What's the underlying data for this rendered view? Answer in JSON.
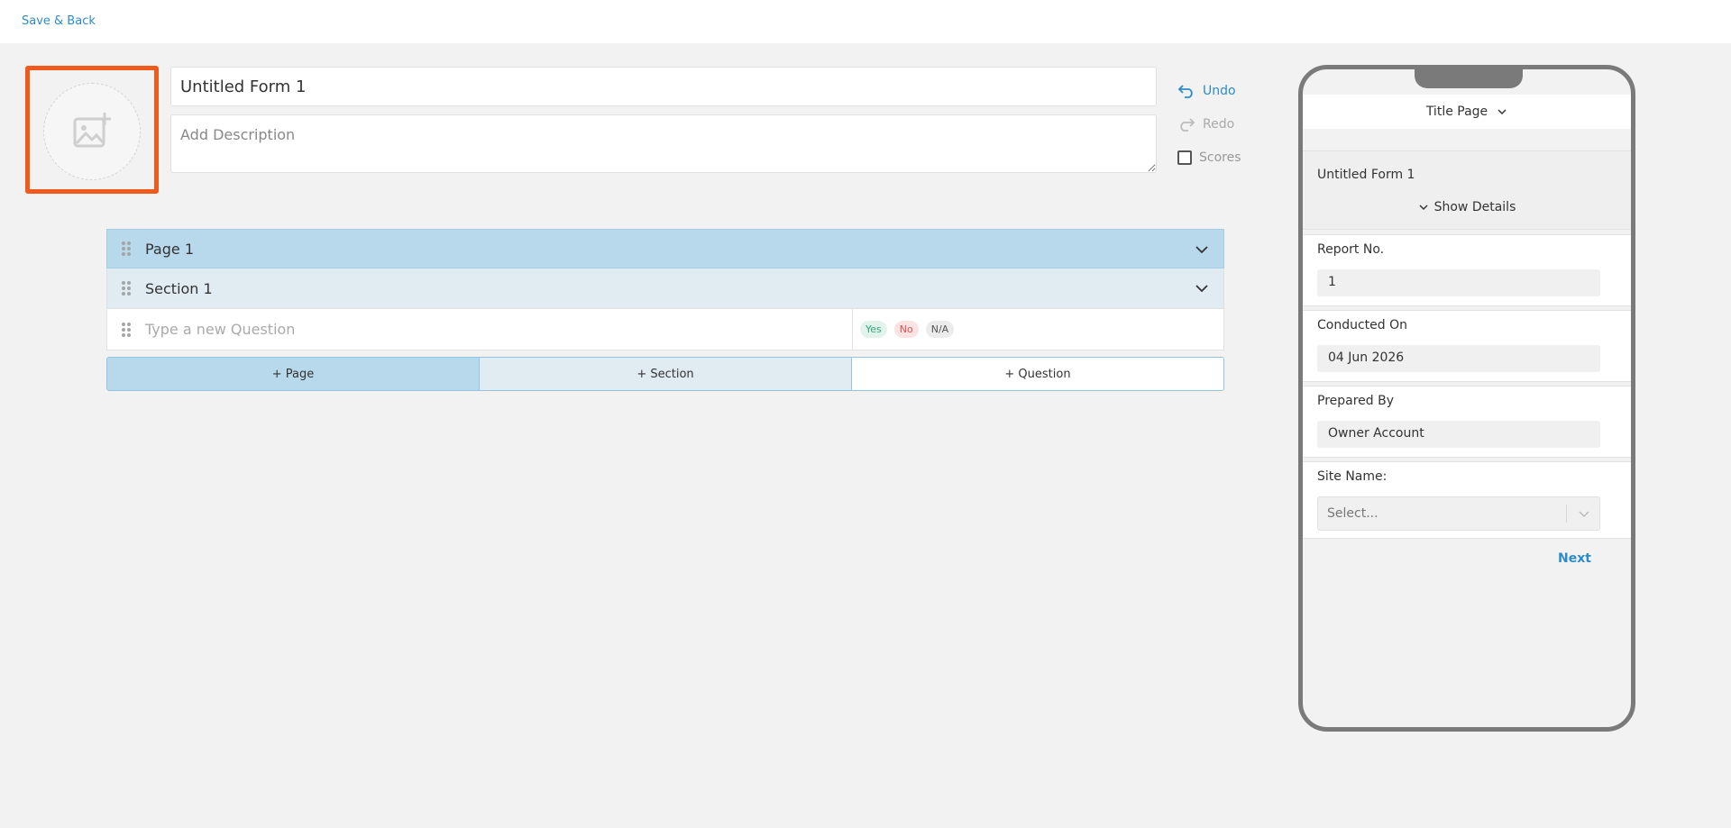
{
  "topbar": {
    "save_back_label": "Save & Back"
  },
  "form": {
    "title": "Untitled Form 1",
    "description_placeholder": "Add Description"
  },
  "actions": {
    "undo_label": "Undo",
    "redo_label": "Redo",
    "scores_label": "Scores"
  },
  "editor": {
    "page_label": "Page 1",
    "section_label": "Section 1",
    "question_placeholder": "Type a new Question",
    "responses": [
      "Yes",
      "No",
      "N/A"
    ]
  },
  "add_bar": {
    "page": "+ Page",
    "section": "+ Section",
    "question": "+ Question"
  },
  "preview": {
    "header": "Title Page",
    "title": "Untitled Form 1",
    "show_details": "Show Details",
    "fields": [
      {
        "label": "Report No.",
        "value": "1"
      },
      {
        "label": "Conducted On",
        "value": "04 Jun 2026"
      },
      {
        "label": "Prepared By",
        "value": "Owner Account"
      }
    ],
    "site_label": "Site Name:",
    "site_placeholder": "Select...",
    "next_label": "Next"
  },
  "colors": {
    "accent": "#2e8bc9",
    "highlight": "#f05a1c",
    "page_row": "#b8d9ec",
    "section_row": "#e1ebf2"
  }
}
